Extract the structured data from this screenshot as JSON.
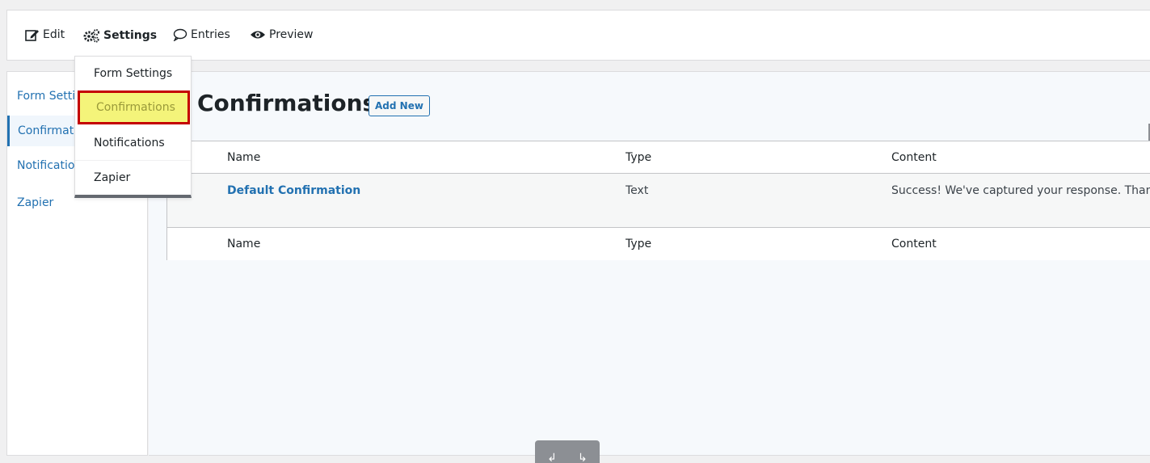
{
  "toolbar": {
    "edit_label": "Edit",
    "settings_label": "Settings",
    "entries_label": "Entries",
    "preview_label": "Preview"
  },
  "dropdown": {
    "items": [
      {
        "label": "Form Settings"
      },
      {
        "label": "Confirmations"
      },
      {
        "label": "Notifications"
      },
      {
        "label": "Zapier"
      }
    ]
  },
  "sidebar": {
    "items": [
      {
        "label": "Form Settings"
      },
      {
        "label": "Confirmations"
      },
      {
        "label": "Notifications"
      },
      {
        "label": "Zapier"
      }
    ]
  },
  "main": {
    "title": "Confirmations",
    "add_new_label": "Add New",
    "table": {
      "headers": [
        "Name",
        "Type",
        "Content"
      ],
      "rows": [
        {
          "name": "Default Confirmation",
          "type": "Text",
          "content": "Success! We've captured your response. Thank"
        }
      ],
      "footers": [
        "Name",
        "Type",
        "Content"
      ]
    }
  },
  "pager": {
    "prev_symbol": "↲",
    "next_symbol": "↳"
  },
  "colors": {
    "accent": "#2271b1",
    "highlight_fill": "#f4f47a",
    "highlight_border": "#c40000"
  }
}
